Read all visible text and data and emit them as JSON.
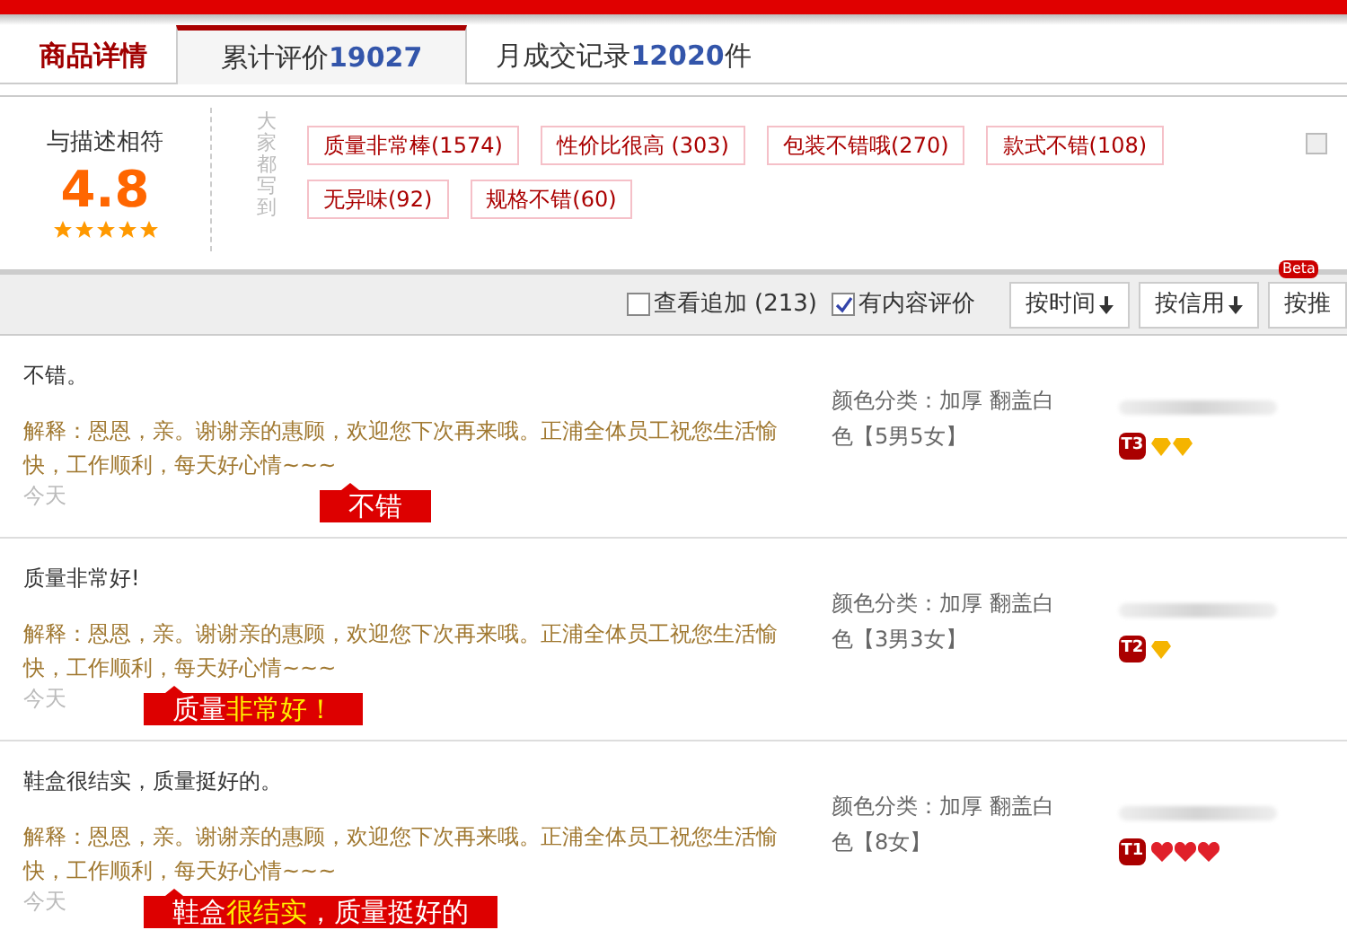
{
  "tabs": [
    {
      "label": "商品详情",
      "selected": false
    },
    {
      "label": "累计评价 ",
      "count": "19027",
      "selected": true
    },
    {
      "label": "月成交记录",
      "count": "12020",
      "suffix": "件",
      "selected": false
    }
  ],
  "summary": {
    "label": "与描述相符",
    "score": "4.8",
    "stars": 5,
    "side_label": "大家都写到",
    "tags": [
      "质量非常棒(1574)",
      "性价比很高 (303)",
      "包装不错哦(270)",
      "款式不错(108)",
      "无异味(92)",
      "规格不错(60)"
    ]
  },
  "toolbar": {
    "filters": [
      {
        "label": "查看追加 (213)",
        "checked": false
      },
      {
        "label": "有内容评价",
        "checked": true
      }
    ],
    "sorts": [
      {
        "label": "按时间",
        "arrow": true
      },
      {
        "label": "按信用",
        "arrow": true
      },
      {
        "label": "按推",
        "arrow": false,
        "badge": "Beta"
      }
    ]
  },
  "reviews": [
    {
      "text": "不错。",
      "reply": "解释：恩恩，亲。谢谢亲的惠顾，欢迎您下次再来哦。正浦全体员工祝您生活愉快，工作顺利，每天好心情~~~",
      "date": "今天",
      "callout": [
        {
          "text": "不错",
          "highlight": false
        }
      ],
      "sku": "颜色分类：加厚 翻盖白色【5男5女】",
      "level": "T3",
      "badges": [
        {
          "kind": "diamond"
        },
        {
          "kind": "diamond"
        }
      ]
    },
    {
      "text": "质量非常好!",
      "reply": "解释：恩恩，亲。谢谢亲的惠顾，欢迎您下次再来哦。正浦全体员工祝您生活愉快，工作顺利，每天好心情~~~",
      "date": "今天",
      "callout": [
        {
          "text": "质量",
          "highlight": false
        },
        {
          "text": "非常好！",
          "highlight": true
        }
      ],
      "sku": "颜色分类：加厚 翻盖白色【3男3女】",
      "level": "T2",
      "badges": [
        {
          "kind": "diamond"
        }
      ]
    },
    {
      "text": "鞋盒很结实，质量挺好的。",
      "reply": "解释：恩恩，亲。谢谢亲的惠顾，欢迎您下次再来哦。正浦全体员工祝您生活愉快，工作顺利，每天好心情~~~",
      "date": "今天",
      "callout": [
        {
          "text": "鞋盒",
          "highlight": false
        },
        {
          "text": "很结实",
          "highlight": true
        },
        {
          "text": "，质量挺好的",
          "highlight": false
        }
      ],
      "sku": "颜色分类：加厚 翻盖白色【8女】",
      "level": "T1",
      "badges": [
        {
          "kind": "heart"
        },
        {
          "kind": "heart"
        },
        {
          "kind": "heart"
        }
      ]
    }
  ]
}
